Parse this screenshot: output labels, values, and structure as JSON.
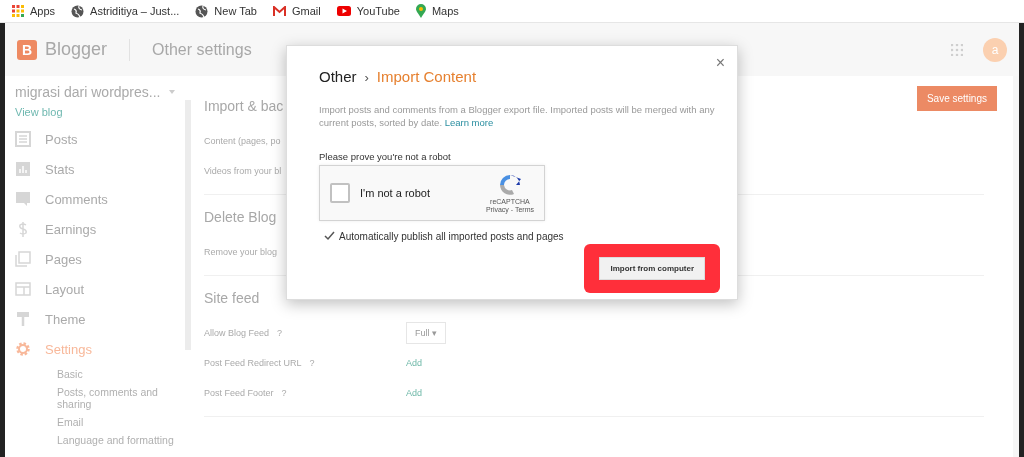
{
  "bookmarks": [
    {
      "kind": "apps",
      "label": "Apps"
    },
    {
      "kind": "globe",
      "label": "Astriditiya – Just..."
    },
    {
      "kind": "globe",
      "label": "New Tab"
    },
    {
      "kind": "gmail",
      "label": "Gmail"
    },
    {
      "kind": "youtube",
      "label": "YouTube"
    },
    {
      "kind": "maps",
      "label": "Maps"
    }
  ],
  "header": {
    "logo_letter": "B",
    "brand": "Blogger",
    "page_title": "Other settings",
    "avatar_letter": "a"
  },
  "sidebar": {
    "blog_name": "migrasi dari wordpres...",
    "view_blog": "View blog",
    "items": [
      {
        "kind": "posts",
        "label": "Posts",
        "selected": false
      },
      {
        "kind": "stats",
        "label": "Stats",
        "selected": false
      },
      {
        "kind": "comments",
        "label": "Comments",
        "selected": false
      },
      {
        "kind": "earnings",
        "label": "Earnings",
        "selected": false
      },
      {
        "kind": "pages",
        "label": "Pages",
        "selected": false
      },
      {
        "kind": "layout",
        "label": "Layout",
        "selected": false
      },
      {
        "kind": "theme",
        "label": "Theme",
        "selected": false
      },
      {
        "kind": "settings",
        "label": "Settings",
        "selected": true
      }
    ],
    "subitems": [
      "Basic",
      "Posts, comments and sharing",
      "Email",
      "Language and formatting"
    ]
  },
  "save_button": "Save settings",
  "sections": [
    {
      "title": "Import & bac",
      "rows": [
        {
          "kind": "text",
          "label": "Content (pages, po"
        },
        {
          "kind": "text",
          "label": "Videos from your bl"
        }
      ]
    },
    {
      "title": "Delete Blog",
      "rows": [
        {
          "kind": "text",
          "label": "Remove your blog"
        }
      ]
    },
    {
      "title": "Site feed",
      "rows": [
        {
          "kind": "select",
          "label": "Allow Blog Feed",
          "help": "?",
          "value": "Full",
          "caret": "▾"
        },
        {
          "kind": "link",
          "label": "Post Feed Redirect URL",
          "help": "?",
          "value": "Add"
        },
        {
          "kind": "link",
          "label": "Post Feed Footer",
          "help": "?",
          "value": "Add"
        }
      ]
    }
  ],
  "dialog": {
    "breadcrumb_parent": "Other",
    "separator": "›",
    "title": "Import Content",
    "close": "×",
    "description": "Import posts and comments from a Blogger export file. Imported posts will be merged with any current posts, sorted by date.",
    "learn_more": "Learn more",
    "captcha_prompt": "Please prove you're not a robot",
    "captcha": {
      "checked": false,
      "label": "I'm not a robot",
      "brand": "reCAPTCHA",
      "links": "Privacy - Terms"
    },
    "auto_publish": {
      "checked": true,
      "label": "Automatically publish all imported posts and pages"
    },
    "import_button": {
      "label": "Import from computer",
      "highlighted": true
    }
  }
}
